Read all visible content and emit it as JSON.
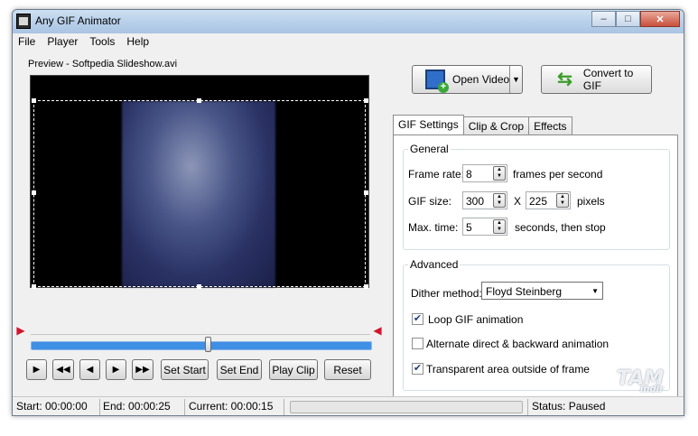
{
  "window": {
    "title": "Any GIF Animator"
  },
  "menu": [
    "File",
    "Player",
    "Tools",
    "Help"
  ],
  "preview": {
    "label": "Preview - Softpedia Slideshow.avi"
  },
  "playback": {
    "buttons": [
      "Set Start",
      "Set End",
      "Play Clip",
      "Reset"
    ],
    "position_fraction": 0.52
  },
  "actions": {
    "open_video": "Open Video",
    "convert": "Convert to GIF"
  },
  "tabs": [
    "GIF Settings",
    "Clip & Crop",
    "Effects"
  ],
  "general": {
    "title": "General",
    "frame_rate_label": "Frame rate:",
    "frame_rate": "8",
    "frame_rate_unit": "frames per second",
    "gif_size_label": "GIF size:",
    "width": "300",
    "size_sep": "X",
    "height": "225",
    "size_unit": "pixels",
    "max_time_label": "Max. time:",
    "max_time": "5",
    "max_time_unit": "seconds, then stop"
  },
  "advanced": {
    "title": "Advanced",
    "dither_label": "Dither method:",
    "dither_value": "Floyd Steinberg",
    "loop": {
      "label": "Loop GIF animation",
      "checked": true
    },
    "alternate": {
      "label": "Alternate direct & backward animation",
      "checked": false
    },
    "transparent": {
      "label": "Transparent area outside of frame",
      "checked": true
    }
  },
  "status": {
    "start": "Start: 00:00:00",
    "end": "End: 00:00:25",
    "current": "Current: 00:00:15",
    "state": "Status: Paused"
  },
  "watermark": {
    "line1": "TAM",
    "line2": "indir"
  }
}
